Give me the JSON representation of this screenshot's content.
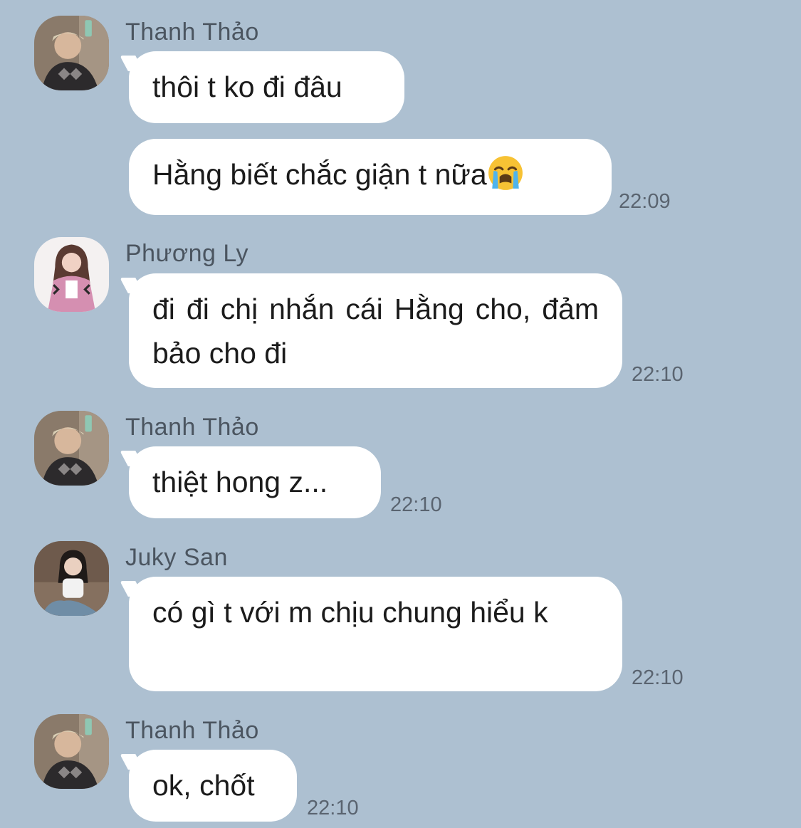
{
  "messages": [
    {
      "sender": "Thanh Thảo",
      "text": "thôi t ko đi đâu",
      "time": ""
    },
    {
      "sender": "",
      "text": "Hằng biết chắc giận t nữa",
      "emoji": "loudly-crying-face-emoji",
      "time": "22:09"
    },
    {
      "sender": "Phương Ly",
      "text": "đi đi chị nhắn cái Hằng cho, đảm bảo cho đi",
      "time": "22:10"
    },
    {
      "sender": "Thanh Thảo",
      "text": "thiệt hong z...",
      "time": "22:10"
    },
    {
      "sender": "Juky San",
      "text": "có gì t với m chịu chung hiểu k",
      "time": "22:10"
    },
    {
      "sender": "Thanh Thảo",
      "text": "ok, chốt",
      "time": "22:10"
    }
  ],
  "colors": {
    "background": "#adc0d1",
    "bubble": "#ffffff",
    "sender_text": "#4b5560",
    "time_text": "#5a6470"
  }
}
